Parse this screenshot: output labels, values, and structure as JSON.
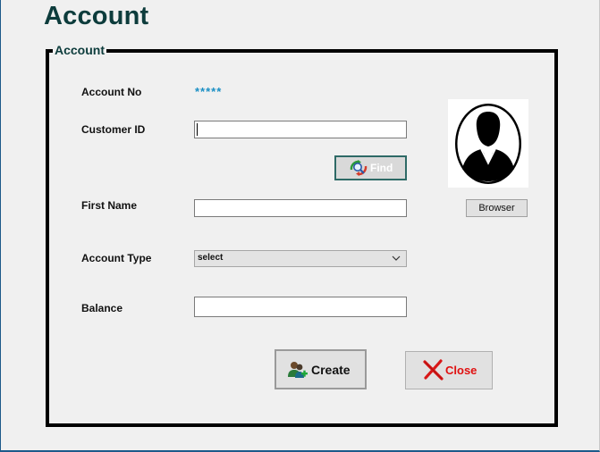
{
  "page": {
    "title": "Account"
  },
  "group": {
    "legend": "Account"
  },
  "form": {
    "account_no_label": "Account No",
    "account_no_value": "*****",
    "customer_id_label": "Customer ID",
    "customer_id_value": "",
    "first_name_label": "First Name",
    "first_name_value": "",
    "account_type_label": "Account Type",
    "account_type_selected": "select",
    "balance_label": "Balance",
    "balance_value": ""
  },
  "buttons": {
    "find": "Find",
    "browser": "Browser",
    "create": "Create",
    "close": "Close"
  },
  "icons": {
    "find": "search-refresh-icon",
    "photo": "user-silhouette-icon",
    "create": "add-user-icon",
    "close": "close-x-icon",
    "dropdown": "chevron-down-icon"
  },
  "colors": {
    "title": "#0d3c3c",
    "masked_value": "#1a8fc4",
    "close_text": "#e01010",
    "find_border": "#2e6a66"
  }
}
